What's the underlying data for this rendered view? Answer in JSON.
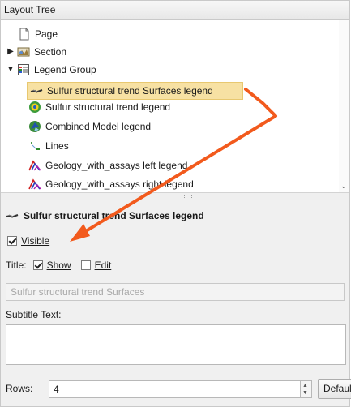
{
  "tree": {
    "header": "Layout Tree",
    "items": [
      {
        "label": "Page",
        "icon": "page-icon",
        "expander": ""
      },
      {
        "label": "Section",
        "icon": "section-icon",
        "expander": "▶"
      },
      {
        "label": "Legend Group",
        "icon": "legend-group-icon",
        "expander": "▼"
      },
      {
        "label": "Sulfur structural trend Surfaces legend",
        "icon": "surfaces-legend-icon",
        "expander": "",
        "selected": true
      },
      {
        "label": "Sulfur structural trend legend",
        "icon": "trend-legend-icon",
        "expander": ""
      },
      {
        "label": "Combined Model legend",
        "icon": "model-legend-icon",
        "expander": ""
      },
      {
        "label": "Lines",
        "icon": "lines-icon",
        "expander": ""
      },
      {
        "label": "Geology_with_assays left legend",
        "icon": "geology-legend-icon",
        "expander": ""
      },
      {
        "label": "Geology_with_assays right legend",
        "icon": "geology-legend-icon",
        "expander": ""
      }
    ]
  },
  "properties": {
    "title": "Sulfur structural trend Surfaces legend",
    "visible_label": "Visible",
    "visible_checked": true,
    "title_label": "Title:",
    "show_label": "Show",
    "show_checked": true,
    "edit_label": "Edit",
    "edit_checked": false,
    "title_text_value": "Sulfur structural trend Surfaces",
    "subtitle_label": "Subtitle Text:",
    "subtitle_value": "",
    "rows_label": "Rows:",
    "rows_value": "4",
    "default_button": "Default"
  },
  "colors": {
    "selection": "#f7e1a3",
    "annotation_arrow": "#f25a1d"
  }
}
